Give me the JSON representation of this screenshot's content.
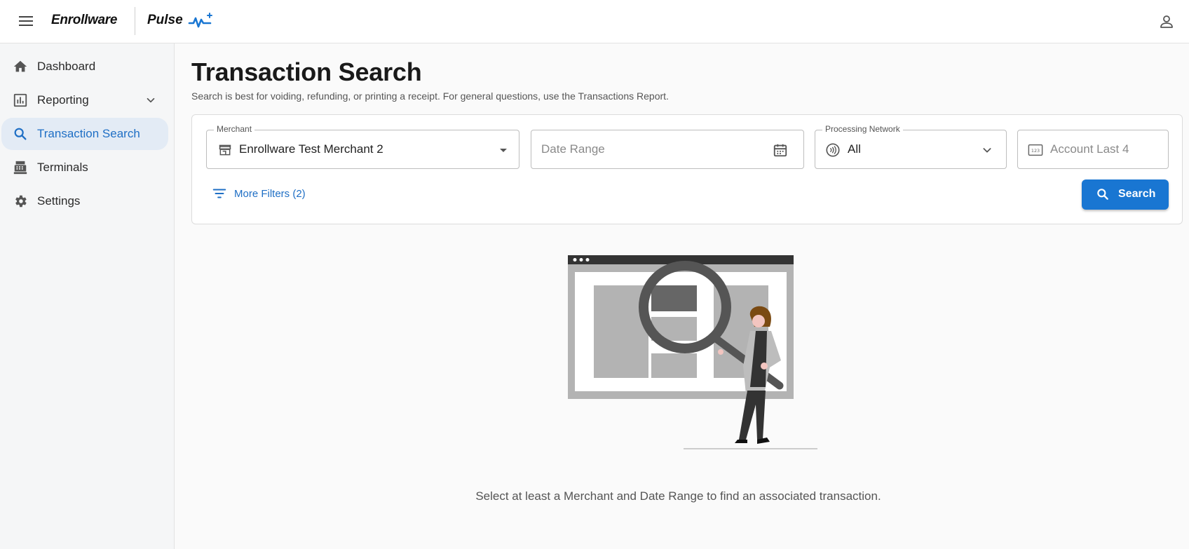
{
  "header": {
    "brand": "Enrollware",
    "product": "Pulse",
    "icons": {
      "menu": "hamburger-menu-icon",
      "pulse": "pulse-wave-icon",
      "user": "account-icon"
    }
  },
  "sidebar": {
    "items": [
      {
        "label": "Dashboard",
        "icon": "home-icon"
      },
      {
        "label": "Reporting",
        "icon": "bar-chart-icon"
      },
      {
        "label": "Transaction Search",
        "icon": "search-icon",
        "active": true
      },
      {
        "label": "Terminals",
        "icon": "terminal-icon"
      },
      {
        "label": "Settings",
        "icon": "gear-icon"
      }
    ]
  },
  "page": {
    "title": "Transaction Search",
    "subtitle": "Search is best for voiding, refunding, or printing a receipt. For general questions, use the Transactions Report."
  },
  "filters": {
    "merchant": {
      "label": "Merchant",
      "value": "Enrollware Test Merchant 2"
    },
    "date_range": {
      "placeholder": "Date Range"
    },
    "network": {
      "label": "Processing Network",
      "value": "All"
    },
    "account": {
      "placeholder": "Account Last 4"
    },
    "more_filters": "More Filters (2)",
    "search_button": "Search"
  },
  "empty_state": {
    "message": "Select at least a Merchant and Date Range to find an associated transaction."
  },
  "colors": {
    "accent": "#1976d2",
    "active_bg": "#e3ebf5",
    "link": "#1f6fc5"
  }
}
